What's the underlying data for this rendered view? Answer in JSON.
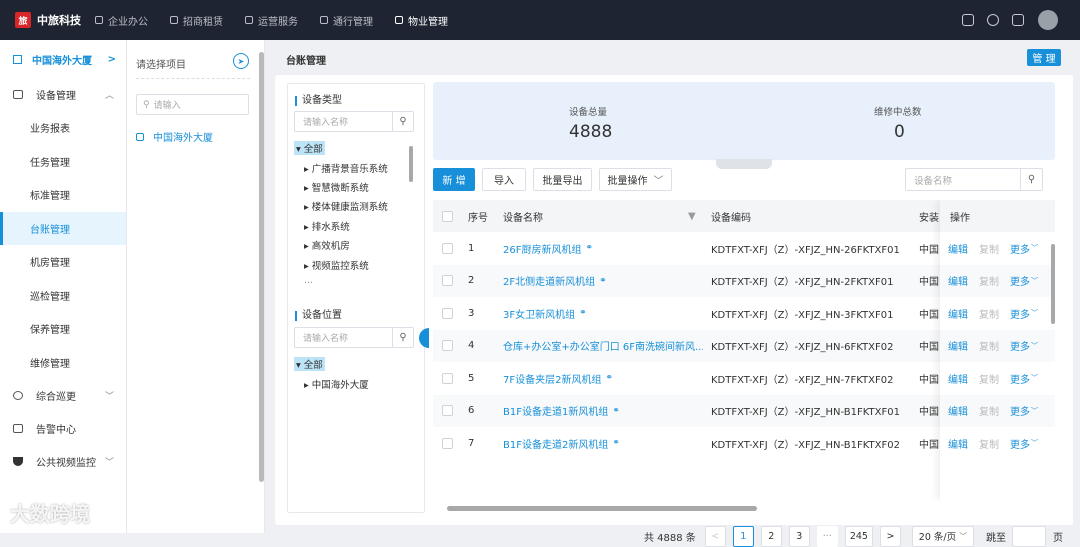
{
  "app": {
    "logo_text": "中旅科技"
  },
  "topnav": [
    {
      "label": "企业办公",
      "active": false
    },
    {
      "label": "招商租赁",
      "active": false
    },
    {
      "label": "运营服务",
      "active": false
    },
    {
      "label": "通行管理",
      "active": false
    },
    {
      "label": "物业管理",
      "active": true
    }
  ],
  "sidebar": {
    "header": "中国海外大厦",
    "groups": [
      {
        "label": "设备管理",
        "items": [
          "业务报表",
          "任务管理",
          "标准管理",
          "台账管理",
          "机房管理",
          "巡检管理",
          "保养管理",
          "维修管理"
        ]
      },
      {
        "label": "综合巡更"
      },
      {
        "label": "告警中心"
      },
      {
        "label": "公共视频监控"
      }
    ],
    "active_item": "台账管理"
  },
  "project": {
    "title": "请选择项目",
    "search_placeholder": "请输入",
    "node": "中国海外大厦"
  },
  "page": {
    "title": "台账管理",
    "manage_button": "管 理"
  },
  "device_type": {
    "title": "设备类型",
    "search_placeholder": "请输入名称",
    "root": "全部",
    "children": [
      "广播背景音乐系统",
      "智慧微断系统",
      "楼体健康监测系统",
      "排水系统",
      "高效机房",
      "视频监控系统",
      "..."
    ]
  },
  "device_location": {
    "title": "设备位置",
    "search_placeholder": "请输入名称",
    "root": "全部",
    "children": [
      "中国海外大厦"
    ]
  },
  "stats": {
    "total_label": "设备总量",
    "total_value": "4888",
    "repair_label": "维修中总数",
    "repair_value": "0"
  },
  "toolbar": {
    "add": "新 增",
    "import": "导入",
    "batch_export": "批量导出",
    "batch_ops": "批量操作",
    "search_placeholder": "设备名称"
  },
  "table": {
    "headers": {
      "index": "序号",
      "name": "设备名称",
      "code": "设备编码",
      "loc": "安装位置",
      "ops": "操作"
    },
    "rows": [
      {
        "index": "1",
        "name": "26F厨房新风机组",
        "code": "KDTFXT-XFJ（Z）-XFJZ_HN-26FKTXF01",
        "loc": "中国"
      },
      {
        "index": "2",
        "name": "2F北侧走道新风机组",
        "code": "KDTFXT-XFJ（Z）-XFJZ_HN-2FKTXF01",
        "loc": "中国"
      },
      {
        "index": "3",
        "name": "3F女卫新风机组",
        "code": "KDTFXT-XFJ（Z）-XFJZ_HN-3FKTXF01",
        "loc": "中国"
      },
      {
        "index": "4",
        "name": "仓库+办公室+办公室门口 6F南洗碗间新风...",
        "code": "KDTFXT-XFJ（Z）-XFJZ_HN-6FKTXF02",
        "loc": "中国"
      },
      {
        "index": "5",
        "name": "7F设备夹层2新风机组",
        "code": "KDTFXT-XFJ（Z）-XFJZ_HN-7FKTXF02",
        "loc": "中国"
      },
      {
        "index": "6",
        "name": "B1F设备走道1新风机组",
        "code": "KDTFXT-XFJ（Z）-XFJZ_HN-B1FKTXF01",
        "loc": "中国"
      },
      {
        "index": "7",
        "name": "B1F设备走道2新风机组",
        "code": "KDTFXT-XFJ（Z）-XFJZ_HN-B1FKTXF02",
        "loc": "中国"
      }
    ],
    "op_edit": "编辑",
    "op_copy": "复制",
    "op_more": "更多"
  },
  "pagination": {
    "total_text": "共 4888 条",
    "pages": [
      "1",
      "2",
      "3",
      "···",
      "245"
    ],
    "current": "1",
    "page_size": "20 条/页",
    "jump_label": "跳至",
    "page_suffix": "页"
  },
  "watermark": "大数跨境"
}
